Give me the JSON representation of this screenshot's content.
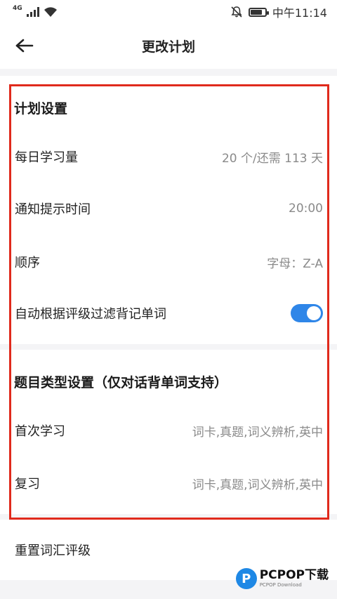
{
  "status_bar": {
    "network": "4G",
    "time": "中午11:14"
  },
  "nav": {
    "title": "更改计划"
  },
  "plan_settings": {
    "title": "计划设置",
    "rows": [
      {
        "label": "每日学习量",
        "value": "20 个/还需 113 天"
      },
      {
        "label": "通知提示时间",
        "value": "20:00"
      },
      {
        "label": "顺序",
        "value": "字母：Z-A"
      }
    ],
    "auto_filter": {
      "label": "自动根据评级过滤背记单词",
      "enabled": true
    }
  },
  "question_settings": {
    "title": "题目类型设置（仅对话背单词支持）",
    "rows": [
      {
        "label": "首次学习",
        "value": "词卡,真题,词义辨析,英中"
      },
      {
        "label": "复习",
        "value": "词卡,真题,词义辨析,英中"
      }
    ]
  },
  "reset": {
    "label": "重置词汇评级"
  },
  "watermark": {
    "logo_letter": "P",
    "main": "PCPOP下载",
    "sub": "PCPOP Download"
  },
  "colors": {
    "accent": "#2f86e8",
    "highlight": "#e02a1c",
    "value_text": "#8a8a8a"
  }
}
